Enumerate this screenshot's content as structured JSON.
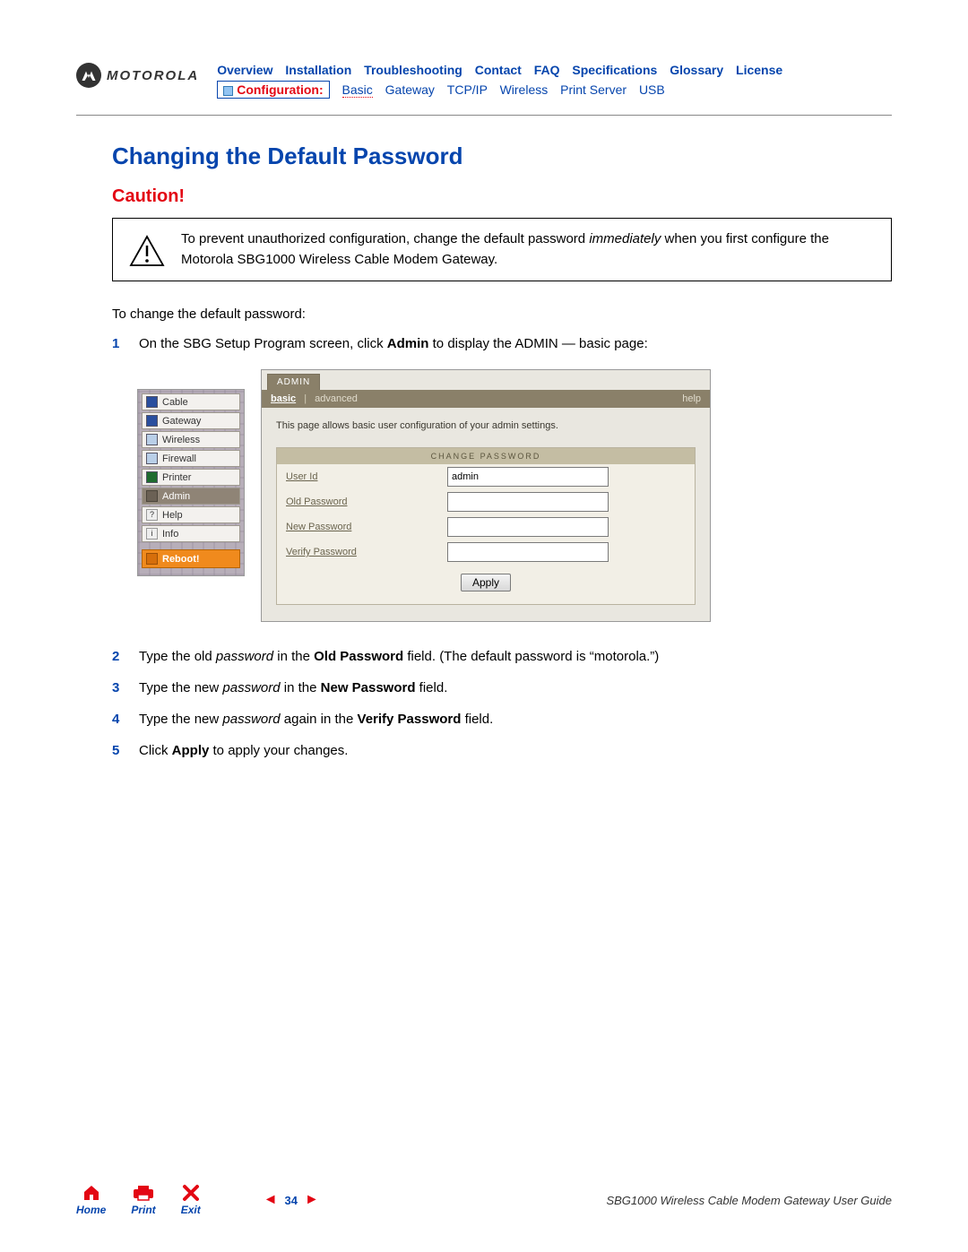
{
  "logo": {
    "text": "MOTOROLA"
  },
  "nav_top": [
    "Overview",
    "Installation",
    "Troubleshooting",
    "Contact",
    "FAQ",
    "Specifications",
    "Glossary",
    "License"
  ],
  "nav_sub": {
    "config_label": "Configuration:",
    "items": [
      "Basic",
      "Gateway",
      "TCP/IP",
      "Wireless",
      "Print Server",
      "USB"
    ]
  },
  "title": "Changing the Default Password",
  "caution_label": "Caution!",
  "caution_text_parts": {
    "a": "To prevent unauthorized configuration, change the default password ",
    "b": "immediately",
    "c": " when you first configure the Motorola SBG1000 Wireless Cable Modem Gateway."
  },
  "intro": "To change the default password:",
  "steps": {
    "s1": {
      "a": "On the SBG Setup Program screen, click ",
      "b": "Admin",
      "c": " to display the ADMIN — basic page:"
    },
    "s2": {
      "a": "Type the old ",
      "b": "password",
      "c": " in the ",
      "d": "Old Password",
      "e": " field. (The default password is “motorola.”)"
    },
    "s3": {
      "a": "Type the new ",
      "b": "password",
      "c": " in the ",
      "d": "New Password",
      "e": " field."
    },
    "s4": {
      "a": "Type the new ",
      "b": "password",
      "c": " again in the ",
      "d": "Verify Password",
      "e": " field."
    },
    "s5": {
      "a": "Click ",
      "b": "Apply",
      "c": " to apply your changes."
    }
  },
  "admin_ui": {
    "sidebar": [
      {
        "label": "Cable",
        "color": "#2a4f9e"
      },
      {
        "label": "Gateway",
        "color": "#2a4f9e"
      },
      {
        "label": "Wireless",
        "color": "#b9cfe8"
      },
      {
        "label": "Firewall",
        "color": "#b9cfe8"
      },
      {
        "label": "Printer",
        "color": "#1e6b2e"
      }
    ],
    "active": "Admin",
    "extra": [
      {
        "label": "Help",
        "mark": "?"
      },
      {
        "label": "Info",
        "mark": "i"
      }
    ],
    "reboot": "Reboot!",
    "tab": "ADMIN",
    "subtabs": {
      "basic": "basic",
      "advanced": "advanced",
      "help": "help"
    },
    "desc": "This page allows basic user configuration of your admin settings.",
    "form_head": "CHANGE PASSWORD",
    "fields": {
      "user_id": {
        "label": "User Id",
        "value": "admin"
      },
      "old_pw": {
        "label": "Old Password",
        "value": ""
      },
      "new_pw": {
        "label": "New Password",
        "value": ""
      },
      "ver_pw": {
        "label": "Verify Password",
        "value": ""
      }
    },
    "apply": "Apply"
  },
  "footer": {
    "home": "Home",
    "print": "Print",
    "exit": "Exit",
    "page": "34",
    "doc": "SBG1000 Wireless Cable Modem Gateway User Guide"
  }
}
